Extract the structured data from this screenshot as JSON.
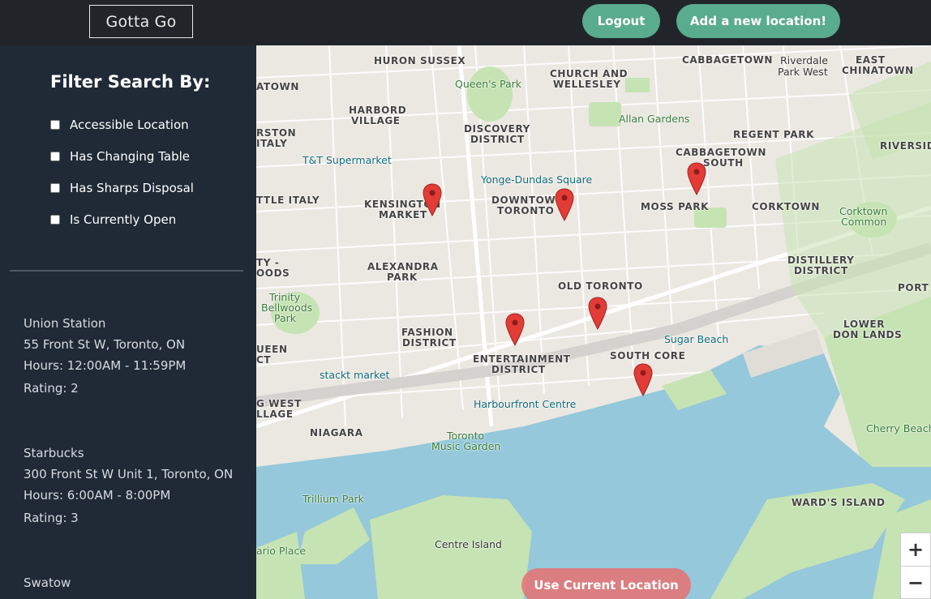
{
  "header": {
    "brand": "Gotta Go",
    "logout_label": "Logout",
    "add_label": "Add a new location!"
  },
  "filters": {
    "title": "Filter Search By:",
    "options": [
      {
        "label": "Accessible Location",
        "checked": false
      },
      {
        "label": "Has Changing Table",
        "checked": false
      },
      {
        "label": "Has Sharps Disposal",
        "checked": false
      },
      {
        "label": "Is Currently Open",
        "checked": false
      }
    ]
  },
  "locations": [
    {
      "name": "Union Station",
      "address": "55 Front St W, Toronto, ON",
      "hours": "Hours: 12:00AM - 11:59PM",
      "rating": "Rating: 2"
    },
    {
      "name": "Starbucks",
      "address": "300 Front St W Unit 1, Toronto, ON",
      "hours": "Hours: 6:00AM - 8:00PM",
      "rating": "Rating: 3"
    },
    {
      "name": "Swatow"
    }
  ],
  "map": {
    "use_location_label": "Use Current Location",
    "zoom_in": "+",
    "zoom_out": "−",
    "labels": {
      "huron_sussex": "HURON SUSSEX",
      "queens_park": "Queen's Park",
      "church_wellesley_1": "CHURCH AND",
      "church_wellesley_2": "WELLESLEY",
      "cabbagetown": "CABBAGETOWN",
      "riverdale_1": "Riverdale",
      "riverdale_2": "Park West",
      "east_chinatown_1": "EAST",
      "east_chinatown_2": "CHINATOWN",
      "harbord_1": "HARBORD",
      "harbord_2": "VILLAGE",
      "discovery_1": "DISCOVERY",
      "discovery_2": "DISTRICT",
      "allan_gardens": "Allan Gardens",
      "regent_park": "REGENT PARK",
      "riverside": "RIVERSIDE",
      "tt_supermarket": "T&T Supermarket",
      "cabbagetown_south_1": "CABBAGETOWN",
      "cabbagetown_south_2": "SOUTH",
      "yonge_dundas": "Yonge-Dundas Square",
      "kensington_1": "KENSINGTON",
      "kensington_2": "MARKET",
      "little_italy": "TTLE ITALY",
      "downtown_1": "DOWNTOWN",
      "downtown_2": "TORONTO",
      "moss_park": "MOSS PARK",
      "corktown": "CORKTOWN",
      "corktown_common_1": "Corktown",
      "corktown_common_2": "Common",
      "alexandra_1": "ALEXANDRA",
      "alexandra_2": "PARK",
      "old_toronto": "OLD TORONTO",
      "distillery_1": "DISTILLERY",
      "distillery_2": "DISTRICT",
      "port": "PORT",
      "trinity_1": "Trinity",
      "trinity_2": "Bellwoods",
      "trinity_3": "Park",
      "fashion_1": "FASHION",
      "fashion_2": "DISTRICT",
      "sugar_beach": "Sugar Beach",
      "lower_don_1": "LOWER",
      "lower_don_2": "DON LANDS",
      "south_core": "SOUTH CORE",
      "entertainment_1": "ENTERTAINMENT",
      "entertainment_2": "DISTRICT",
      "stackt": "stackt market",
      "harbourfront": "Harbourfront Centre",
      "cherry_beach": "Cherry Beach",
      "niagara": "NIAGARA",
      "toronto_music_1": "Toronto",
      "toronto_music_2": "Music Garden",
      "trillium": "Trillium Park",
      "wards_island": "WARD'S ISLAND",
      "centre_island": "Centre Island",
      "ario_place": "ario Place",
      "rston": "RSTON",
      "italy": "ITALY",
      "atown": "ATOWN",
      "ty_woods_1": "TY -",
      "ty_woods_2": "OODS",
      "ueen": "UEEN",
      "ct": "CT",
      "wg_west_1": "G WEST",
      "wg_west_2": "LLAGE"
    }
  }
}
